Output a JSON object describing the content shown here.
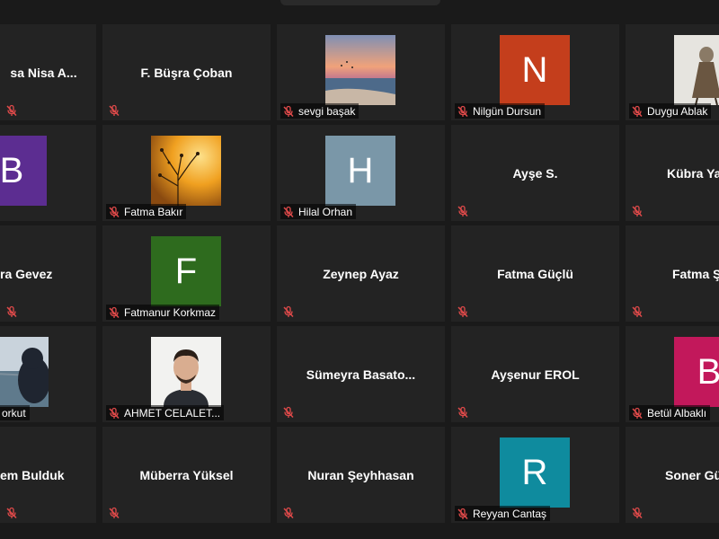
{
  "tiles": [
    {
      "display_name": "sa Nisa A...",
      "caption": "",
      "avatar": null
    },
    {
      "display_name": "F. Büşra Çoban",
      "caption": "",
      "avatar": null
    },
    {
      "display_name": "",
      "caption": "sevgi başak",
      "avatar": "photo-sunset"
    },
    {
      "display_name": "",
      "caption": "Nilgün Dursun",
      "avatar": "N",
      "color": "#c43e1c"
    },
    {
      "display_name": "",
      "caption": "Duygu Ablak",
      "avatar": "photo-figure"
    },
    {
      "display_name": "",
      "caption": "",
      "avatar": "B",
      "color": "#5c2d91"
    },
    {
      "display_name": "",
      "caption": "Fatma Bakır",
      "avatar": "photo-tree"
    },
    {
      "display_name": "",
      "caption": "Hilal Orhan",
      "avatar": "H",
      "color": "#7a97a8"
    },
    {
      "display_name": "Ayşe S.",
      "caption": "",
      "avatar": null
    },
    {
      "display_name": "Kübra Ya",
      "caption": "",
      "avatar": null
    },
    {
      "display_name": "ra Gevez",
      "caption": "",
      "avatar": null
    },
    {
      "display_name": "",
      "caption": "Fatmanur Korkmaz",
      "avatar": "F",
      "color": "#2e6b1e"
    },
    {
      "display_name": "Zeynep Ayaz",
      "caption": "",
      "avatar": null
    },
    {
      "display_name": "Fatma Güçlü",
      "caption": "",
      "avatar": null
    },
    {
      "display_name": "Fatma Ş",
      "caption": "",
      "avatar": null
    },
    {
      "display_name": "",
      "caption": "orkut",
      "avatar": "photo-sea"
    },
    {
      "display_name": "",
      "caption": "AHMET CELALET...",
      "avatar": "photo-man"
    },
    {
      "display_name": "Sümeyra  Basato...",
      "caption": "",
      "avatar": null
    },
    {
      "display_name": "Ayşenur EROL",
      "caption": "",
      "avatar": null
    },
    {
      "display_name": "",
      "caption": "Betül Albaklı",
      "avatar": "B",
      "color": "#c2185b"
    },
    {
      "display_name": "em Bulduk",
      "caption": "",
      "avatar": null
    },
    {
      "display_name": "Müberra Yüksel",
      "caption": "",
      "avatar": null
    },
    {
      "display_name": "Nuran Şeyhhasan",
      "caption": "",
      "avatar": null
    },
    {
      "display_name": "",
      "caption": "Reyyan Cantaş",
      "avatar": "R",
      "color": "#0f8b9e"
    },
    {
      "display_name": "Soner Gü",
      "caption": "",
      "avatar": null
    }
  ],
  "colors": {
    "background": "#1a1a1a",
    "tile": "#232323",
    "mic_muted": "#e04a4a"
  }
}
